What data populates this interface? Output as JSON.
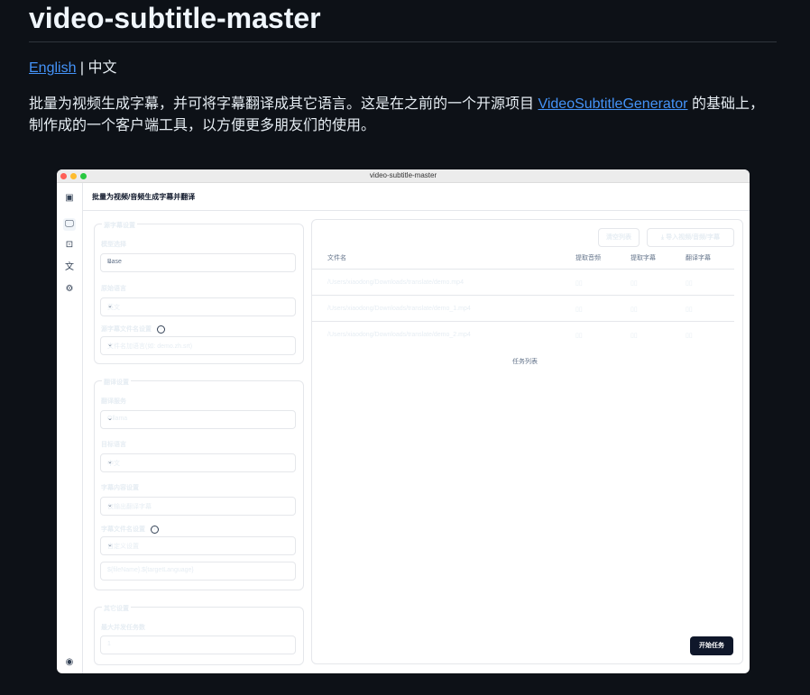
{
  "readme": {
    "title": "video-subtitle-master",
    "lang_link": "English",
    "lang_sep": " | ",
    "lang_current": "中文",
    "desc_before": "批量为视频生成字幕，并可将字幕翻译成其它语言。这是在之前的一个开源项目 ",
    "desc_link": "VideoSubtitleGenerator",
    "desc_after": " 的基础上，制作成的一个客户端工具，以方便更多朋友们的使用。"
  },
  "window": {
    "title": "video-subtitle-master",
    "header": "批量为视频/音频生成字幕并翻译",
    "sidebar": [
      {
        "icon": "app-logo-icon",
        "glyph": "▣"
      },
      {
        "icon": "monitor-icon",
        "glyph": "🖵"
      },
      {
        "icon": "robot-icon",
        "glyph": "⊡"
      },
      {
        "icon": "translate-icon",
        "glyph": "文"
      },
      {
        "icon": "gear-icon",
        "glyph": "⚙"
      },
      {
        "icon": "github-icon",
        "glyph": "◉"
      }
    ]
  },
  "source_settings": {
    "title": "源字幕设置",
    "model_label": "模型选择",
    "model_value": "Base",
    "language_label": "原始语言",
    "language_value": "英文",
    "filename_label": "源字幕文件名设置",
    "filename_value": "文件名加语言(如: demo.zh.srt)"
  },
  "translate_settings": {
    "title": "翻译设置",
    "service_label": "翻译服务",
    "service_value": "Ollama",
    "target_label": "目标语言",
    "target_value": "中文",
    "content_label": "字幕内容设置",
    "content_value": "仅输出翻译字幕",
    "filename_label": "字幕文件名设置",
    "filename_value": "自定义设置",
    "template_value": "${fileName}.${targetLanguage}"
  },
  "other_settings": {
    "title": "其它设置",
    "concurrency_label": "最大并发任务数",
    "concurrency_value": "1"
  },
  "tasks": {
    "clear_button": "清空列表",
    "import_button": "导入视频/音频/字幕",
    "columns": [
      "文件名",
      "提取音频",
      "提取字幕",
      "翻译字幕"
    ],
    "rows": [
      {
        "file": "/Users/xiaodong/Downloads/translate/demo.mp4",
        "audio": "▯▯",
        "extract": "▯▯",
        "translate": "▯▯"
      },
      {
        "file": "/Users/xiaodong/Downloads/translate/demo_1.mp4",
        "audio": "▯▯",
        "extract": "▯▯",
        "translate": "▯▯"
      },
      {
        "file": "/Users/xiaodong/Downloads/translate/demo_2.mp4",
        "audio": "▯▯",
        "extract": "▯▯",
        "translate": "▯▯"
      }
    ],
    "caption": "任务列表",
    "start_button": "开始任务"
  }
}
